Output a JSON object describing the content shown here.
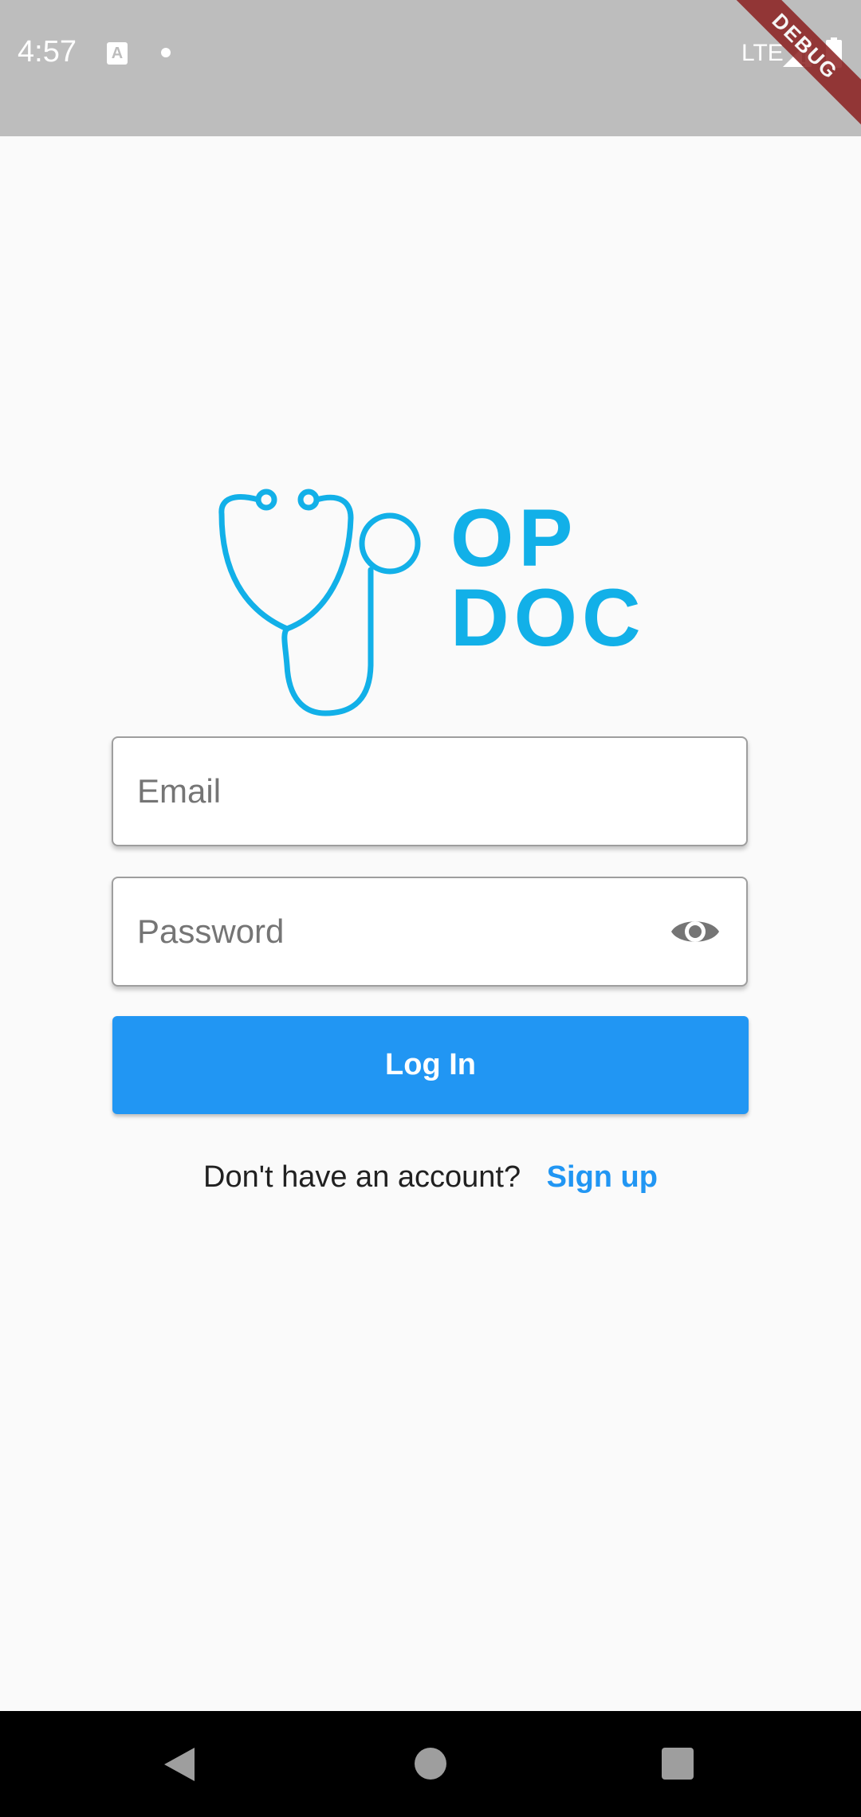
{
  "status_bar": {
    "time": "4:57",
    "network": "LTE",
    "notification_icons": [
      "text-a-icon",
      "dot-icon"
    ]
  },
  "debug_banner": {
    "label": "DEBUG"
  },
  "logo": {
    "text_line1": "OP",
    "text_line2": "DOC",
    "icon": "stethoscope-icon"
  },
  "login_form": {
    "email_placeholder": "Email",
    "email_value": "",
    "password_placeholder": "Password",
    "password_value": "",
    "password_toggle_icon": "eye-icon",
    "login_label": "Log In"
  },
  "signup": {
    "prompt": "Don't have an account?",
    "link_label": "Sign up"
  },
  "colors": {
    "brand": "#12b0e8",
    "primary": "#2196f3",
    "status_bar": "#bdbdbd",
    "background": "#fafafa"
  }
}
